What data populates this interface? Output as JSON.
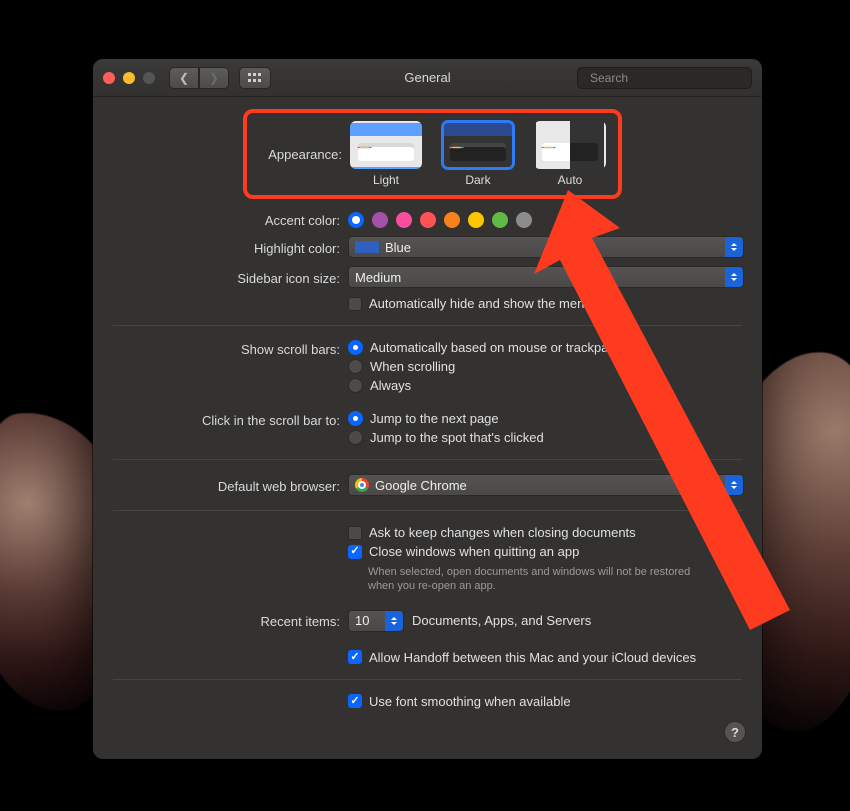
{
  "window": {
    "title": "General"
  },
  "search": {
    "placeholder": "Search"
  },
  "labels": {
    "appearance": "Appearance:",
    "accent": "Accent color:",
    "highlight": "Highlight color:",
    "sidebar_size": "Sidebar icon size:",
    "menubar_autohide": "Automatically hide and show the menu bar",
    "scrollbars": "Show scroll bars:",
    "scrollclick": "Click in the scroll bar to:",
    "default_browser": "Default web browser:",
    "ask_changes": "Ask to keep changes when closing documents",
    "close_windows": "Close windows when quitting an app",
    "close_windows_note": "When selected, open documents and windows will not be restored when you re-open an app.",
    "recent": "Recent items:",
    "recent_suffix": "Documents, Apps, and Servers",
    "handoff": "Allow Handoff between this Mac and your iCloud devices",
    "font_smoothing": "Use font smoothing when available"
  },
  "appearance": {
    "options": [
      {
        "id": "light",
        "label": "Light"
      },
      {
        "id": "dark",
        "label": "Dark"
      },
      {
        "id": "auto",
        "label": "Auto"
      }
    ],
    "selected": "dark"
  },
  "accent_colors": [
    {
      "name": "blue",
      "hex": "#0a66ff",
      "selected": true
    },
    {
      "name": "purple",
      "hex": "#a550a7"
    },
    {
      "name": "pink",
      "hex": "#f74f9e"
    },
    {
      "name": "red",
      "hex": "#ff5257"
    },
    {
      "name": "orange",
      "hex": "#f7821b"
    },
    {
      "name": "yellow",
      "hex": "#ffc600"
    },
    {
      "name": "green",
      "hex": "#62ba46"
    },
    {
      "name": "graphite",
      "hex": "#8c8c8c"
    }
  ],
  "highlight_color": {
    "value": "Blue"
  },
  "sidebar_size": {
    "value": "Medium"
  },
  "menubar_autohide_checked": false,
  "scrollbars": {
    "options": [
      "Automatically based on mouse or trackpad",
      "When scrolling",
      "Always"
    ],
    "selected_index": 0
  },
  "scrollclick": {
    "options": [
      "Jump to the next page",
      "Jump to the spot that's clicked"
    ],
    "selected_index": 0
  },
  "default_browser": {
    "value": "Google Chrome"
  },
  "ask_changes_checked": false,
  "close_windows_checked": true,
  "recent_items": {
    "value": "10"
  },
  "handoff_checked": true,
  "font_smoothing_checked": true,
  "help_label": "?"
}
